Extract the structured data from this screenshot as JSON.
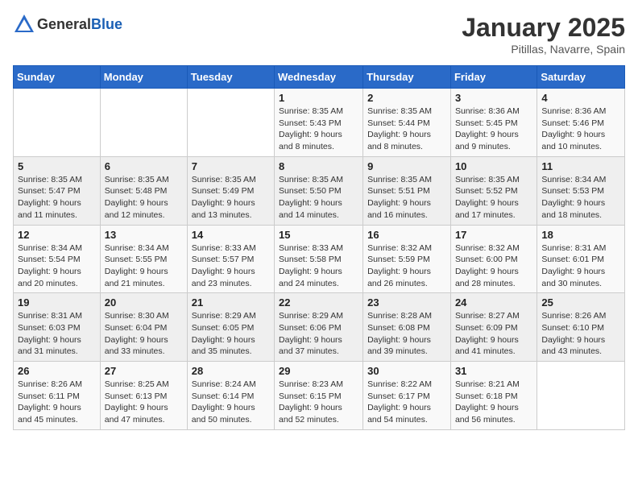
{
  "header": {
    "logo_general": "General",
    "logo_blue": "Blue",
    "month": "January 2025",
    "location": "Pitillas, Navarre, Spain"
  },
  "weekdays": [
    "Sunday",
    "Monday",
    "Tuesday",
    "Wednesday",
    "Thursday",
    "Friday",
    "Saturday"
  ],
  "weeks": [
    [
      {
        "day": "",
        "sunrise": "",
        "sunset": "",
        "daylight": ""
      },
      {
        "day": "",
        "sunrise": "",
        "sunset": "",
        "daylight": ""
      },
      {
        "day": "",
        "sunrise": "",
        "sunset": "",
        "daylight": ""
      },
      {
        "day": "1",
        "sunrise": "Sunrise: 8:35 AM",
        "sunset": "Sunset: 5:43 PM",
        "daylight": "Daylight: 9 hours and 8 minutes."
      },
      {
        "day": "2",
        "sunrise": "Sunrise: 8:35 AM",
        "sunset": "Sunset: 5:44 PM",
        "daylight": "Daylight: 9 hours and 8 minutes."
      },
      {
        "day": "3",
        "sunrise": "Sunrise: 8:36 AM",
        "sunset": "Sunset: 5:45 PM",
        "daylight": "Daylight: 9 hours and 9 minutes."
      },
      {
        "day": "4",
        "sunrise": "Sunrise: 8:36 AM",
        "sunset": "Sunset: 5:46 PM",
        "daylight": "Daylight: 9 hours and 10 minutes."
      }
    ],
    [
      {
        "day": "5",
        "sunrise": "Sunrise: 8:35 AM",
        "sunset": "Sunset: 5:47 PM",
        "daylight": "Daylight: 9 hours and 11 minutes."
      },
      {
        "day": "6",
        "sunrise": "Sunrise: 8:35 AM",
        "sunset": "Sunset: 5:48 PM",
        "daylight": "Daylight: 9 hours and 12 minutes."
      },
      {
        "day": "7",
        "sunrise": "Sunrise: 8:35 AM",
        "sunset": "Sunset: 5:49 PM",
        "daylight": "Daylight: 9 hours and 13 minutes."
      },
      {
        "day": "8",
        "sunrise": "Sunrise: 8:35 AM",
        "sunset": "Sunset: 5:50 PM",
        "daylight": "Daylight: 9 hours and 14 minutes."
      },
      {
        "day": "9",
        "sunrise": "Sunrise: 8:35 AM",
        "sunset": "Sunset: 5:51 PM",
        "daylight": "Daylight: 9 hours and 16 minutes."
      },
      {
        "day": "10",
        "sunrise": "Sunrise: 8:35 AM",
        "sunset": "Sunset: 5:52 PM",
        "daylight": "Daylight: 9 hours and 17 minutes."
      },
      {
        "day": "11",
        "sunrise": "Sunrise: 8:34 AM",
        "sunset": "Sunset: 5:53 PM",
        "daylight": "Daylight: 9 hours and 18 minutes."
      }
    ],
    [
      {
        "day": "12",
        "sunrise": "Sunrise: 8:34 AM",
        "sunset": "Sunset: 5:54 PM",
        "daylight": "Daylight: 9 hours and 20 minutes."
      },
      {
        "day": "13",
        "sunrise": "Sunrise: 8:34 AM",
        "sunset": "Sunset: 5:55 PM",
        "daylight": "Daylight: 9 hours and 21 minutes."
      },
      {
        "day": "14",
        "sunrise": "Sunrise: 8:33 AM",
        "sunset": "Sunset: 5:57 PM",
        "daylight": "Daylight: 9 hours and 23 minutes."
      },
      {
        "day": "15",
        "sunrise": "Sunrise: 8:33 AM",
        "sunset": "Sunset: 5:58 PM",
        "daylight": "Daylight: 9 hours and 24 minutes."
      },
      {
        "day": "16",
        "sunrise": "Sunrise: 8:32 AM",
        "sunset": "Sunset: 5:59 PM",
        "daylight": "Daylight: 9 hours and 26 minutes."
      },
      {
        "day": "17",
        "sunrise": "Sunrise: 8:32 AM",
        "sunset": "Sunset: 6:00 PM",
        "daylight": "Daylight: 9 hours and 28 minutes."
      },
      {
        "day": "18",
        "sunrise": "Sunrise: 8:31 AM",
        "sunset": "Sunset: 6:01 PM",
        "daylight": "Daylight: 9 hours and 30 minutes."
      }
    ],
    [
      {
        "day": "19",
        "sunrise": "Sunrise: 8:31 AM",
        "sunset": "Sunset: 6:03 PM",
        "daylight": "Daylight: 9 hours and 31 minutes."
      },
      {
        "day": "20",
        "sunrise": "Sunrise: 8:30 AM",
        "sunset": "Sunset: 6:04 PM",
        "daylight": "Daylight: 9 hours and 33 minutes."
      },
      {
        "day": "21",
        "sunrise": "Sunrise: 8:29 AM",
        "sunset": "Sunset: 6:05 PM",
        "daylight": "Daylight: 9 hours and 35 minutes."
      },
      {
        "day": "22",
        "sunrise": "Sunrise: 8:29 AM",
        "sunset": "Sunset: 6:06 PM",
        "daylight": "Daylight: 9 hours and 37 minutes."
      },
      {
        "day": "23",
        "sunrise": "Sunrise: 8:28 AM",
        "sunset": "Sunset: 6:08 PM",
        "daylight": "Daylight: 9 hours and 39 minutes."
      },
      {
        "day": "24",
        "sunrise": "Sunrise: 8:27 AM",
        "sunset": "Sunset: 6:09 PM",
        "daylight": "Daylight: 9 hours and 41 minutes."
      },
      {
        "day": "25",
        "sunrise": "Sunrise: 8:26 AM",
        "sunset": "Sunset: 6:10 PM",
        "daylight": "Daylight: 9 hours and 43 minutes."
      }
    ],
    [
      {
        "day": "26",
        "sunrise": "Sunrise: 8:26 AM",
        "sunset": "Sunset: 6:11 PM",
        "daylight": "Daylight: 9 hours and 45 minutes."
      },
      {
        "day": "27",
        "sunrise": "Sunrise: 8:25 AM",
        "sunset": "Sunset: 6:13 PM",
        "daylight": "Daylight: 9 hours and 47 minutes."
      },
      {
        "day": "28",
        "sunrise": "Sunrise: 8:24 AM",
        "sunset": "Sunset: 6:14 PM",
        "daylight": "Daylight: 9 hours and 50 minutes."
      },
      {
        "day": "29",
        "sunrise": "Sunrise: 8:23 AM",
        "sunset": "Sunset: 6:15 PM",
        "daylight": "Daylight: 9 hours and 52 minutes."
      },
      {
        "day": "30",
        "sunrise": "Sunrise: 8:22 AM",
        "sunset": "Sunset: 6:17 PM",
        "daylight": "Daylight: 9 hours and 54 minutes."
      },
      {
        "day": "31",
        "sunrise": "Sunrise: 8:21 AM",
        "sunset": "Sunset: 6:18 PM",
        "daylight": "Daylight: 9 hours and 56 minutes."
      },
      {
        "day": "",
        "sunrise": "",
        "sunset": "",
        "daylight": ""
      }
    ]
  ]
}
